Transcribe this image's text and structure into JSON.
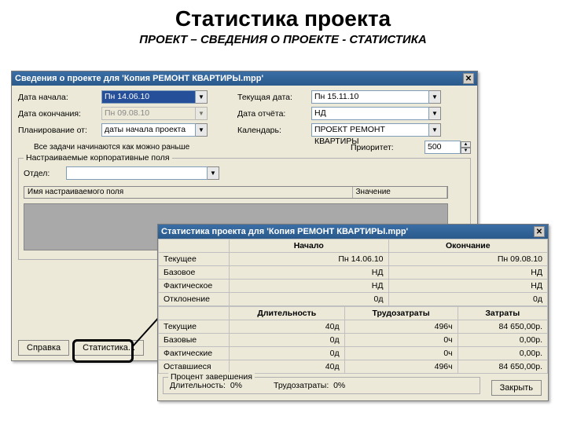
{
  "slide": {
    "title": "Статистика проекта",
    "subtitle": "ПРОЕКТ – СВЕДЕНИЯ О ПРОЕКТЕ - СТАТИСТИКА"
  },
  "info_win": {
    "title": "Сведения о проекте для 'Копия РЕМОНТ КВАРТИРЫ.mpp'",
    "labels": {
      "start": "Дата начала:",
      "end": "Дата окончания:",
      "plan_from": "Планирование от:",
      "curr_date": "Текущая дата:",
      "report_date": "Дата отчёта:",
      "calendar": "Календарь:",
      "priority": "Приоритет:"
    },
    "values": {
      "start": "Пн 14.06.10",
      "end": "Пн 09.08.10",
      "plan_from": "даты начала проекта",
      "curr_date": "Пн 15.11.10",
      "report_date": "НД",
      "calendar": "ПРОЕКТ РЕМОНТ КВАРТИРЫ",
      "priority": "500"
    },
    "note": "Все задачи начинаются как можно раньше",
    "custom_group": "Настраиваемые корпоративные поля",
    "dept_label": "Отдел:",
    "col1": "Имя настраиваемого поля",
    "col2": "Значение",
    "help_btn": "Справка",
    "stat_btn": "Статистика..."
  },
  "stat_win": {
    "title": "Статистика проекта для 'Копия РЕМОНТ КВАРТИРЫ.mpp'",
    "hdr": {
      "start": "Начало",
      "end": "Окончание",
      "dur": "Длительность",
      "work": "Трудозатраты",
      "cost": "Затраты"
    },
    "rows1": [
      {
        "lab": "Текущее",
        "start": "Пн 14.06.10",
        "end": "Пн 09.08.10"
      },
      {
        "lab": "Базовое",
        "start": "НД",
        "end": "НД"
      },
      {
        "lab": "Фактическое",
        "start": "НД",
        "end": "НД"
      },
      {
        "lab": "Отклонение",
        "start": "0д",
        "end": "0д"
      }
    ],
    "rows2": [
      {
        "lab": "Текущие",
        "dur": "40д",
        "work": "496ч",
        "cost": "84 650,00р."
      },
      {
        "lab": "Базовые",
        "dur": "0д",
        "work": "0ч",
        "cost": "0,00р."
      },
      {
        "lab": "Фактические",
        "dur": "0д",
        "work": "0ч",
        "cost": "0,00р."
      },
      {
        "lab": "Оставшиеся",
        "dur": "40д",
        "work": "496ч",
        "cost": "84 650,00р."
      }
    ],
    "pct_title": "Процент завершения",
    "pct_dur_lbl": "Длительность:",
    "pct_dur_val": "0%",
    "pct_work_lbl": "Трудозатраты:",
    "pct_work_val": "0%",
    "close_btn": "Закрыть"
  }
}
